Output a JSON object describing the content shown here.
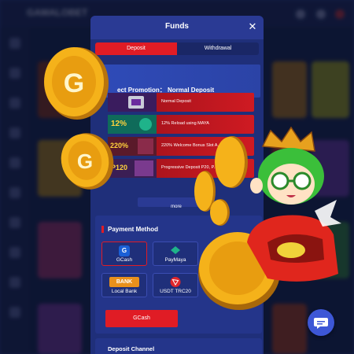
{
  "background": {
    "logo_text": "GAMALOBET"
  },
  "modal": {
    "title": "Funds",
    "close_symbol": "✕",
    "tabs": [
      {
        "label": "Deposit",
        "active": true
      },
      {
        "label": "Withdrawal",
        "active": false
      }
    ],
    "promotion_label": "ect Promotion： Normal Deposit",
    "promotions": [
      {
        "label": "Normal Deposit",
        "thumb_text": ""
      },
      {
        "label": "12% Reload using MAYA",
        "thumb_text": "12%"
      },
      {
        "label": "220% Welcome Bonus Slot A...",
        "thumb_text": "220%"
      },
      {
        "label": "Progressive Deposit P20, P...",
        "thumb_text": "P120"
      }
    ],
    "more_label": "more",
    "payment_method": {
      "title": "Payment Method",
      "options": [
        {
          "label": "GCash",
          "icon": "gcash-icon",
          "icon_text": "G",
          "selected": true
        },
        {
          "label": "PayMaya",
          "icon": "paymaya-icon",
          "icon_text": "",
          "selected": false
        },
        {
          "label": "Local Bank",
          "icon": "bank-icon",
          "icon_text": "BANK",
          "selected": false
        },
        {
          "label": "USDT TRC20",
          "icon": "tron-icon",
          "icon_text": "",
          "selected": false
        }
      ],
      "confirm_label": "GCash"
    },
    "deposit_channel_title": "Deposit Channel"
  },
  "colors": {
    "accent_red": "#e01c25",
    "modal_bg": "#1f2f7a",
    "chat_blue": "#3d57d6"
  }
}
